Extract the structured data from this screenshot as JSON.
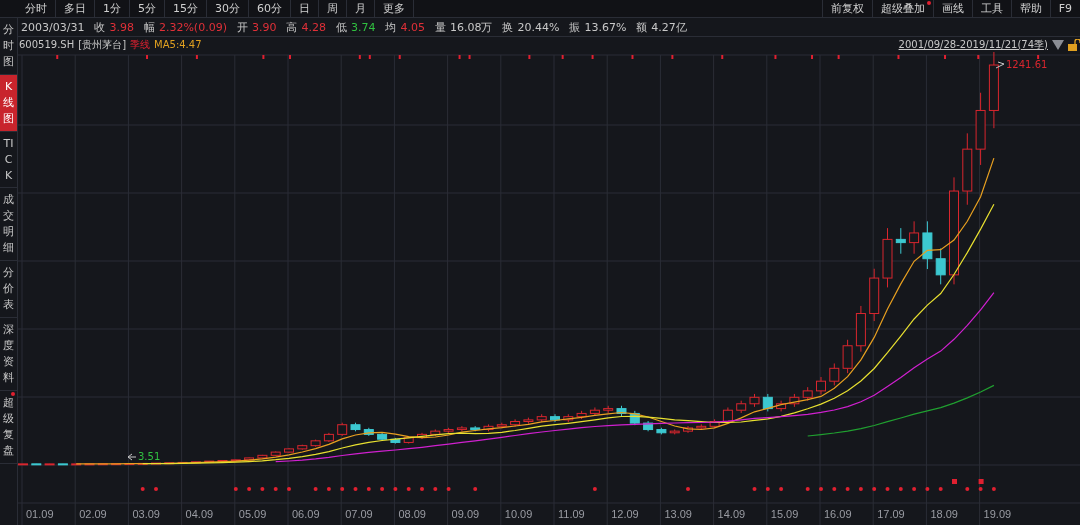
{
  "toolbar": {
    "period_tabs": [
      "分时",
      "多日",
      "1分",
      "5分",
      "15分",
      "30分",
      "60分",
      "日",
      "周",
      "月",
      "更多"
    ],
    "right_buttons": [
      {
        "label": "前复权",
        "badge": false
      },
      {
        "label": "超级叠加",
        "badge": true
      },
      {
        "label": "画线",
        "badge": false
      },
      {
        "label": "工具",
        "badge": false
      },
      {
        "label": "帮助",
        "badge": false
      },
      {
        "label": "F9",
        "badge": false
      }
    ]
  },
  "quote_line": {
    "date": "2003/03/31",
    "fields": [
      {
        "label": "收",
        "value": "3.98",
        "color": "#e03038"
      },
      {
        "label": "幅",
        "value": "2.32%(0.09)",
        "color": "#e03038"
      },
      {
        "label": "开",
        "value": "3.90",
        "color": "#e03038"
      },
      {
        "label": "高",
        "value": "4.28",
        "color": "#e03038"
      },
      {
        "label": "低",
        "value": "3.74",
        "color": "#30c040"
      },
      {
        "label": "均",
        "value": "4.05",
        "color": "#e03038"
      },
      {
        "label": "量",
        "value": "16.08万",
        "color": "#c8c8c8"
      },
      {
        "label": "换",
        "value": "20.44%",
        "color": "#c8c8c8"
      },
      {
        "label": "振",
        "value": "13.67%",
        "color": "#c8c8c8"
      },
      {
        "label": "额",
        "value": "4.27亿",
        "color": "#c8c8c8"
      }
    ]
  },
  "sidebar": {
    "tabs": [
      {
        "label": "分时图",
        "selected": false,
        "badge": false
      },
      {
        "label": "K线图",
        "selected": true,
        "badge": false
      },
      {
        "label": "TICK",
        "selected": false,
        "badge": false
      },
      {
        "label": "成交明细",
        "selected": false,
        "badge": false
      },
      {
        "label": "分价表",
        "selected": false,
        "badge": false
      },
      {
        "label": "深度资料",
        "selected": false,
        "badge": false
      },
      {
        "label": "超级复盘",
        "selected": false,
        "badge": true
      }
    ]
  },
  "chart_header": {
    "code": "600519.SH",
    "name": "[贵州茅台]",
    "period": "季线",
    "ma": "MA5:4.47",
    "range": "2001/09/28-2019/11/21(74季)"
  },
  "chart": {
    "max_label": "1241.61",
    "min_label": "3.51",
    "x_labels": [
      "01.09",
      "02.09",
      "03.09",
      "04.09",
      "05.09",
      "06.09",
      "07.09",
      "08.09",
      "09.09",
      "10.09",
      "11.09",
      "12.09",
      "13.09",
      "14.09",
      "15.09",
      "16.09",
      "17.09",
      "18.09",
      "19.09"
    ]
  }
}
